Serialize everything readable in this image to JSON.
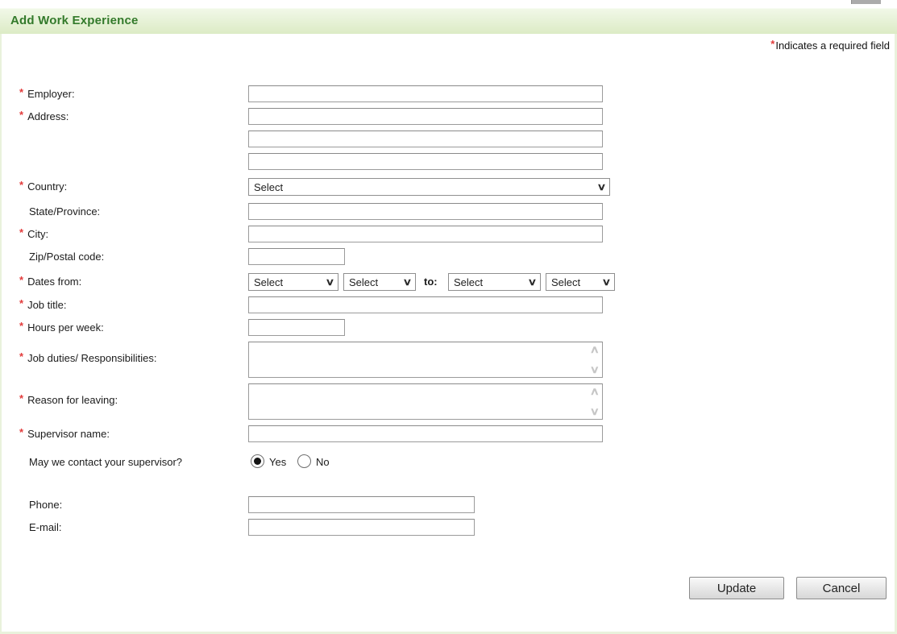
{
  "header": {
    "title": "Add Work Experience"
  },
  "required_note": {
    "marker": "*",
    "text": "Indicates a required field"
  },
  "misc": {
    "required_marker": "*"
  },
  "icons": {
    "chevron_down": "∨",
    "scroll_up": "∧",
    "scroll_down": "∨"
  },
  "colors": {
    "header_text": "#337a2b",
    "required": "#e23b3b",
    "header_bg_top": "#f1f8e8",
    "header_bg_bottom": "#dcebc5",
    "panel_border": "#e9f2dc"
  },
  "fields": {
    "employer": {
      "label": "Employer:",
      "required": true,
      "value": ""
    },
    "address": {
      "label": "Address:",
      "required": true,
      "values": [
        "",
        "",
        ""
      ]
    },
    "country": {
      "label": "Country:",
      "required": true,
      "selected": "Select"
    },
    "state": {
      "label": "State/Province:",
      "required": false,
      "value": ""
    },
    "city": {
      "label": "City:",
      "required": true,
      "value": ""
    },
    "zip": {
      "label": "Zip/Postal code:",
      "required": false,
      "value": ""
    },
    "dates": {
      "label": "Dates from:",
      "required": true,
      "to_label": "to:",
      "from_month": "Select",
      "from_year": "Select",
      "to_month": "Select",
      "to_year": "Select"
    },
    "job_title": {
      "label": "Job title:",
      "required": true,
      "value": ""
    },
    "hours": {
      "label": "Hours per week:",
      "required": true,
      "value": ""
    },
    "job_duties": {
      "label": "Job duties/ Responsibilities:",
      "required": true,
      "value": ""
    },
    "reason": {
      "label": "Reason for leaving:",
      "required": true,
      "value": ""
    },
    "supervisor": {
      "label": "Supervisor name:",
      "required": true,
      "value": ""
    },
    "contact_supervisor": {
      "label": "May we contact your supervisor?",
      "options": [
        {
          "label": "Yes",
          "selected": true
        },
        {
          "label": "No",
          "selected": false
        }
      ]
    },
    "phone": {
      "label": "Phone:",
      "required": false,
      "value": ""
    },
    "email": {
      "label": "E-mail:",
      "required": false,
      "value": ""
    }
  },
  "buttons": {
    "update": "Update",
    "cancel": "Cancel"
  }
}
